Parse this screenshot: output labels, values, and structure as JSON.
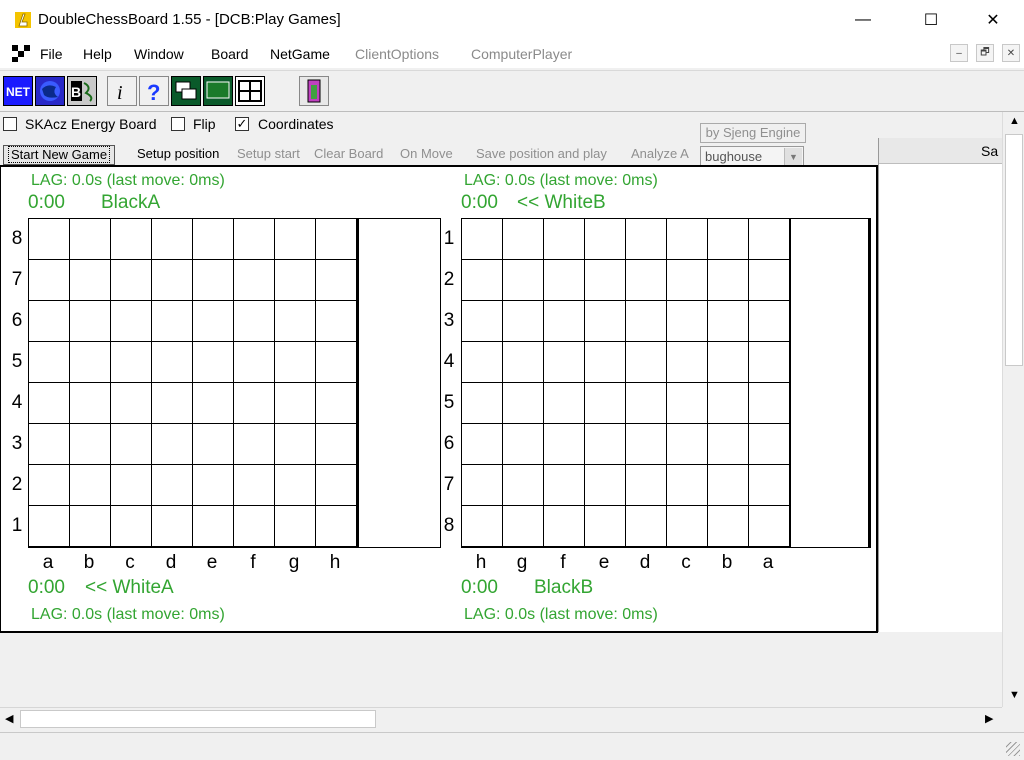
{
  "window": {
    "title": "DoubleChessBoard 1.55 - [DCB:Play Games]",
    "icon": "pawn-app-icon"
  },
  "window_controls": {
    "minimize": "—",
    "maximize": "☐",
    "close": "✕"
  },
  "menu": {
    "items": [
      {
        "label": "File",
        "enabled": true
      },
      {
        "label": "Help",
        "enabled": true
      },
      {
        "label": "Window",
        "enabled": true
      },
      {
        "label": "Board",
        "enabled": true
      },
      {
        "label": "NetGame",
        "enabled": true
      },
      {
        "label": "ClientOptions",
        "enabled": false
      },
      {
        "label": "ComputerPlayer",
        "enabled": false
      }
    ],
    "mdi_controls": [
      "–",
      "🗗",
      "✕"
    ]
  },
  "toolbar": {
    "buttons": [
      "net-icon",
      "globe-icon",
      "bughouse-icon",
      "info-icon",
      "help-icon",
      "window-cascade-icon",
      "board-icon",
      "grid-icon",
      "exit-door-icon"
    ]
  },
  "options": {
    "energy_board": {
      "label": "SKAcz Energy Board",
      "checked": false
    },
    "flip": {
      "label": "Flip",
      "checked": false
    },
    "coordinates": {
      "label": "Coordinates",
      "checked": true
    },
    "checkmark": "✓"
  },
  "actions": {
    "start_new_game": "Start New Game",
    "setup_position": "Setup position",
    "setup_start": "Setup start",
    "clear_board": "Clear Board",
    "on_move": "On Move",
    "save_and_play": "Save position and play",
    "analyze": "Analyze A",
    "engine": "by Sjeng Engine",
    "variant": "bughouse"
  },
  "side_panel": {
    "header": "Sa"
  },
  "boards": {
    "left": {
      "lag_top": "LAG: 0.0s (last move: 0ms)",
      "clock_top": "0:00",
      "player_top": "BlackA",
      "lag_bottom": "LAG: 0.0s (last move: 0ms)",
      "clock_bottom": "0:00",
      "player_bottom": "<< WhiteA",
      "ranks": [
        "8",
        "7",
        "6",
        "5",
        "4",
        "3",
        "2",
        "1"
      ],
      "files": [
        "a",
        "b",
        "c",
        "d",
        "e",
        "f",
        "g",
        "h"
      ]
    },
    "right": {
      "lag_top": "LAG: 0.0s (last move: 0ms)",
      "clock_top": "0:00",
      "player_top": "<< WhiteB",
      "lag_bottom": "LAG: 0.0s (last move: 0ms)",
      "clock_bottom": "0:00",
      "player_bottom": "BlackB",
      "ranks": [
        "1",
        "2",
        "3",
        "4",
        "5",
        "6",
        "7",
        "8"
      ],
      "files": [
        "h",
        "g",
        "f",
        "e",
        "d",
        "c",
        "b",
        "a"
      ]
    }
  },
  "scroll": {
    "up": "▲",
    "down": "▼",
    "left": "◀",
    "right": "▶"
  }
}
